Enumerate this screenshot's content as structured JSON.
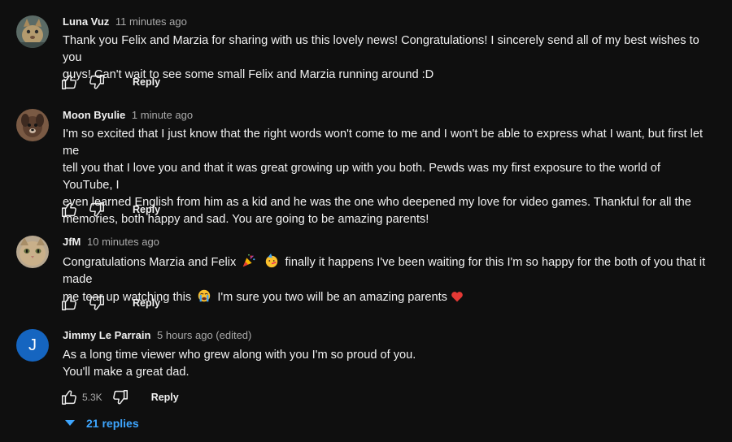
{
  "comments": [
    {
      "author": "Luna Vuz",
      "timestamp": "11 minutes ago",
      "lines": [
        "Thank you Felix and Marzia for sharing with us this lovely news! Congratulations! I sincerely send all of my best wishes to you",
        "guys! Can't wait to see some small Felix and Marzia running around :D"
      ],
      "reply_label": "Reply",
      "avatar_icon": "cat-photo-avatar"
    },
    {
      "author": "Moon Byulie",
      "timestamp": "1 minute ago",
      "lines": [
        "I'm so excited that I just know that the right words won't come to me and I won't be able to express what I want, but first let me",
        "tell you that I love you and that it was great growing up with you both. Pewds was my first exposure to the world of YouTube, I",
        "even learned English from him as a kid and he was the one who deepened my love for video games. Thankful for all the",
        "memories, both happy and sad. You are going to be amazing parents!"
      ],
      "reply_label": "Reply",
      "avatar_icon": "dog-photo-avatar"
    },
    {
      "author": "JfM",
      "timestamp": "10 minutes ago",
      "line1_a": "Congratulations Marzia and Felix",
      "line1_b": "finally it happens I've been waiting for this I'm so happy for the both of you that it made",
      "line2_a": "me tear up watching this",
      "line2_b": "I'm sure you two will be an amazing parents",
      "emojis": [
        "party-popper-emoji",
        "partying-face-emoji",
        "loudly-crying-face-emoji",
        "red-heart-emoji"
      ],
      "reply_label": "Reply",
      "avatar_icon": "cat-face-photo-avatar"
    },
    {
      "author": "Jimmy Le Parrain",
      "timestamp": "5 hours ago (edited)",
      "avatar_letter": "J",
      "avatar_color": "#1565c0",
      "lines": [
        "As a long time viewer who grew along with you I'm so proud of you.",
        "You'll make a great dad."
      ],
      "like_count": "5.3K",
      "reply_label": "Reply",
      "replies_label": "21 replies"
    }
  ],
  "colors": {
    "background": "#0f0f0f",
    "text": "#f1f1f1",
    "secondary_text": "#aaaaaa",
    "link_blue": "#3ea6ff"
  }
}
